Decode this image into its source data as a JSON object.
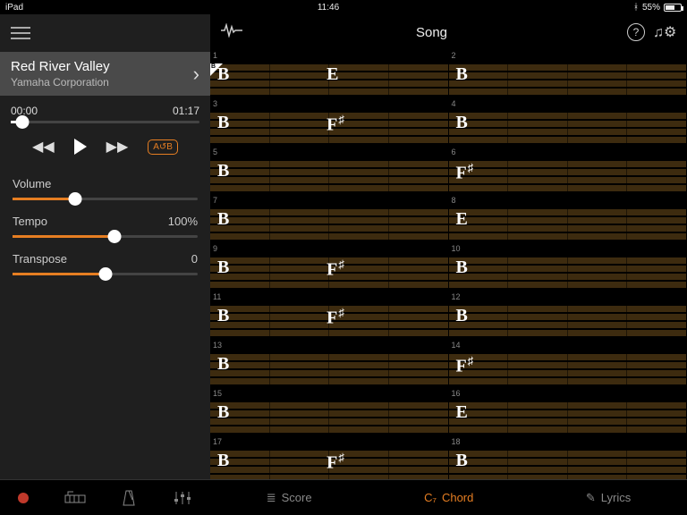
{
  "status": {
    "device": "iPad",
    "time": "11:46",
    "battery_pct": "55%"
  },
  "song": {
    "title": "Red River Valley",
    "artist": "Yamaha Corporation"
  },
  "playback": {
    "elapsed": "00:00",
    "total": "01:17",
    "position_pct": 6,
    "loop_label": "A↺B"
  },
  "controls": {
    "volume": {
      "label": "Volume",
      "value_pct": 34
    },
    "tempo": {
      "label": "Tempo",
      "display": "100%",
      "value_pct": 55
    },
    "transpose": {
      "label": "Transpose",
      "display": "0",
      "value_pct": 50
    }
  },
  "header": {
    "title": "Song"
  },
  "bottom_tabs_right": [
    {
      "icon": "≣",
      "label": "Score",
      "active": false
    },
    {
      "icon": "C₇",
      "label": "Chord",
      "active": true
    },
    {
      "icon": "✎",
      "label": "Lyrics",
      "active": false
    }
  ],
  "measures": [
    {
      "n": 1,
      "chords": [
        {
          "pos": 3,
          "root": "B"
        },
        {
          "pos": 49,
          "root": "E"
        }
      ],
      "start": true
    },
    {
      "n": 2,
      "chords": [
        {
          "pos": 3,
          "root": "B"
        }
      ]
    },
    {
      "n": 3,
      "chords": [
        {
          "pos": 3,
          "root": "B"
        },
        {
          "pos": 49,
          "root": "F",
          "sup": "♯"
        }
      ]
    },
    {
      "n": 4,
      "chords": [
        {
          "pos": 3,
          "root": "B"
        }
      ]
    },
    {
      "n": 5,
      "chords": [
        {
          "pos": 3,
          "root": "B"
        }
      ]
    },
    {
      "n": 6,
      "chords": [
        {
          "pos": 3,
          "root": "F",
          "sup": "♯"
        }
      ]
    },
    {
      "n": 7,
      "chords": [
        {
          "pos": 3,
          "root": "B"
        }
      ]
    },
    {
      "n": 8,
      "chords": [
        {
          "pos": 3,
          "root": "E"
        }
      ]
    },
    {
      "n": 9,
      "chords": [
        {
          "pos": 3,
          "root": "B"
        },
        {
          "pos": 49,
          "root": "F",
          "sup": "♯"
        }
      ]
    },
    {
      "n": 10,
      "chords": [
        {
          "pos": 3,
          "root": "B"
        }
      ]
    },
    {
      "n": 11,
      "chords": [
        {
          "pos": 3,
          "root": "B"
        },
        {
          "pos": 49,
          "root": "F",
          "sup": "♯"
        }
      ]
    },
    {
      "n": 12,
      "chords": [
        {
          "pos": 3,
          "root": "B"
        }
      ]
    },
    {
      "n": 13,
      "chords": [
        {
          "pos": 3,
          "root": "B"
        }
      ]
    },
    {
      "n": 14,
      "chords": [
        {
          "pos": 3,
          "root": "F",
          "sup": "♯"
        }
      ]
    },
    {
      "n": 15,
      "chords": [
        {
          "pos": 3,
          "root": "B"
        }
      ]
    },
    {
      "n": 16,
      "chords": [
        {
          "pos": 3,
          "root": "E"
        }
      ]
    },
    {
      "n": 17,
      "chords": [
        {
          "pos": 3,
          "root": "B"
        },
        {
          "pos": 49,
          "root": "F",
          "sup": "♯"
        }
      ]
    },
    {
      "n": 18,
      "chords": [
        {
          "pos": 3,
          "root": "B"
        }
      ]
    }
  ]
}
